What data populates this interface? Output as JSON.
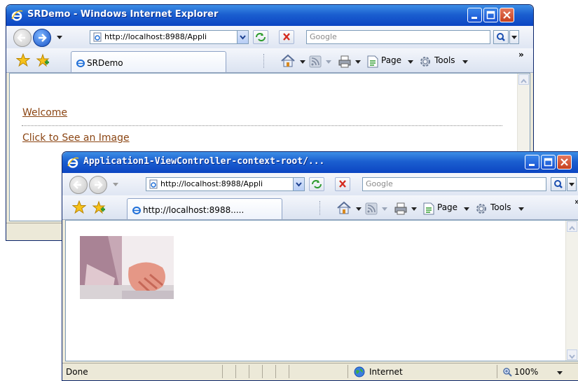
{
  "window_back": {
    "title": "SRDemo - Windows Internet Explorer",
    "address": "http://localhost:8988/Appli",
    "search_placeholder": "Google",
    "tab_label": "SRDemo",
    "page_label": "Page",
    "tools_label": "Tools",
    "overflow": "»",
    "links": [
      "Welcome",
      "Click to See an Image"
    ]
  },
  "window_front": {
    "title": "Application1-ViewController-context-root/...",
    "address": "http://localhost:8988/Appli",
    "search_placeholder": "Google",
    "tab_label": "http://localhost:8988.....",
    "page_label": "Page",
    "tools_label": "Tools",
    "overflow": "»",
    "status": {
      "text": "Done",
      "zone": "Internet",
      "zoom": "100%"
    }
  },
  "colors": {
    "title_bar": "#1b5fd0",
    "link": "#8b4513",
    "chrome": "#ece9d8"
  },
  "icons": [
    "ie-logo-icon",
    "back-arrow-icon",
    "forward-arrow-icon",
    "page-icon",
    "refresh-icon",
    "stop-icon",
    "search-icon",
    "favorites-star-icon",
    "add-favorites-icon",
    "home-icon",
    "feeds-icon",
    "print-icon",
    "tools-gear-icon",
    "internet-globe-icon",
    "zoom-icon",
    "minimize-icon",
    "maximize-icon",
    "close-icon"
  ]
}
